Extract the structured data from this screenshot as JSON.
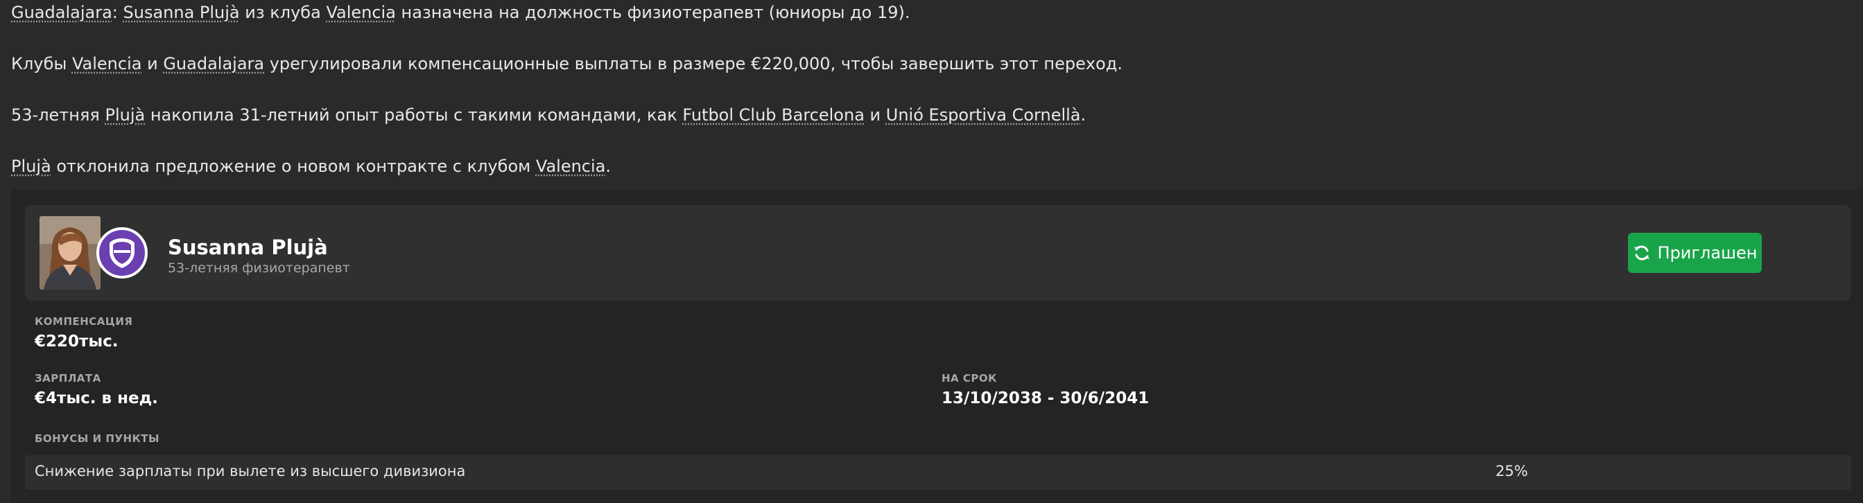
{
  "news": {
    "p1": {
      "club": "Guadalajara",
      "sep": ": ",
      "person": "Susanna Plujà",
      "mid": " из клуба ",
      "from_club": "Valencia",
      "rest": " назначена на должность физиотерапевт (юниоры до 19)."
    },
    "p2": {
      "pre": "Клубы ",
      "club_a": "Valencia",
      "and": " и ",
      "club_b": "Guadalajara",
      "rest": " урегулировали компенсационные выплаты в размере €220,000, чтобы завершить этот переход."
    },
    "p3": {
      "pre": "53-летняя ",
      "person": "Plujà",
      "mid": " накопила 31-летний опыт работы с такими командами, как ",
      "team_a": "Futbol Club Barcelona",
      "and": " и ",
      "team_b": "Unió Esportiva Cornellà",
      "end": "."
    },
    "p4": {
      "person": "Plujà",
      "mid": " отклонила предложение о новом контракте с клубом ",
      "club": "Valencia",
      "end": "."
    }
  },
  "staff": {
    "name": "Susanna Plujà",
    "subtitle": "53-летняя физиотерапевт",
    "invite_label": "Приглашен",
    "photo_icon": "person-photo",
    "badge_icon": "club-shield-icon"
  },
  "contract": {
    "compensation_label": "КОМПЕНСАЦИЯ",
    "compensation_value": "€220тыс.",
    "wage_label": "ЗАРПЛАТА",
    "wage_value": "€4тыс. в нед.",
    "term_label": "НА СРОК",
    "term_value": "13/10/2038 - 30/6/2041",
    "bonuses_label": "БОНУСЫ И ПУНКТЫ",
    "bonuses": [
      {
        "label": "Снижение зарплаты при вылете из высшего дивизиона",
        "value": "25%"
      }
    ]
  },
  "colors": {
    "background": "#2a2a2a",
    "card": "#303030",
    "invite_button": "#1aa44a",
    "club_badge": "#6a3fb0"
  }
}
